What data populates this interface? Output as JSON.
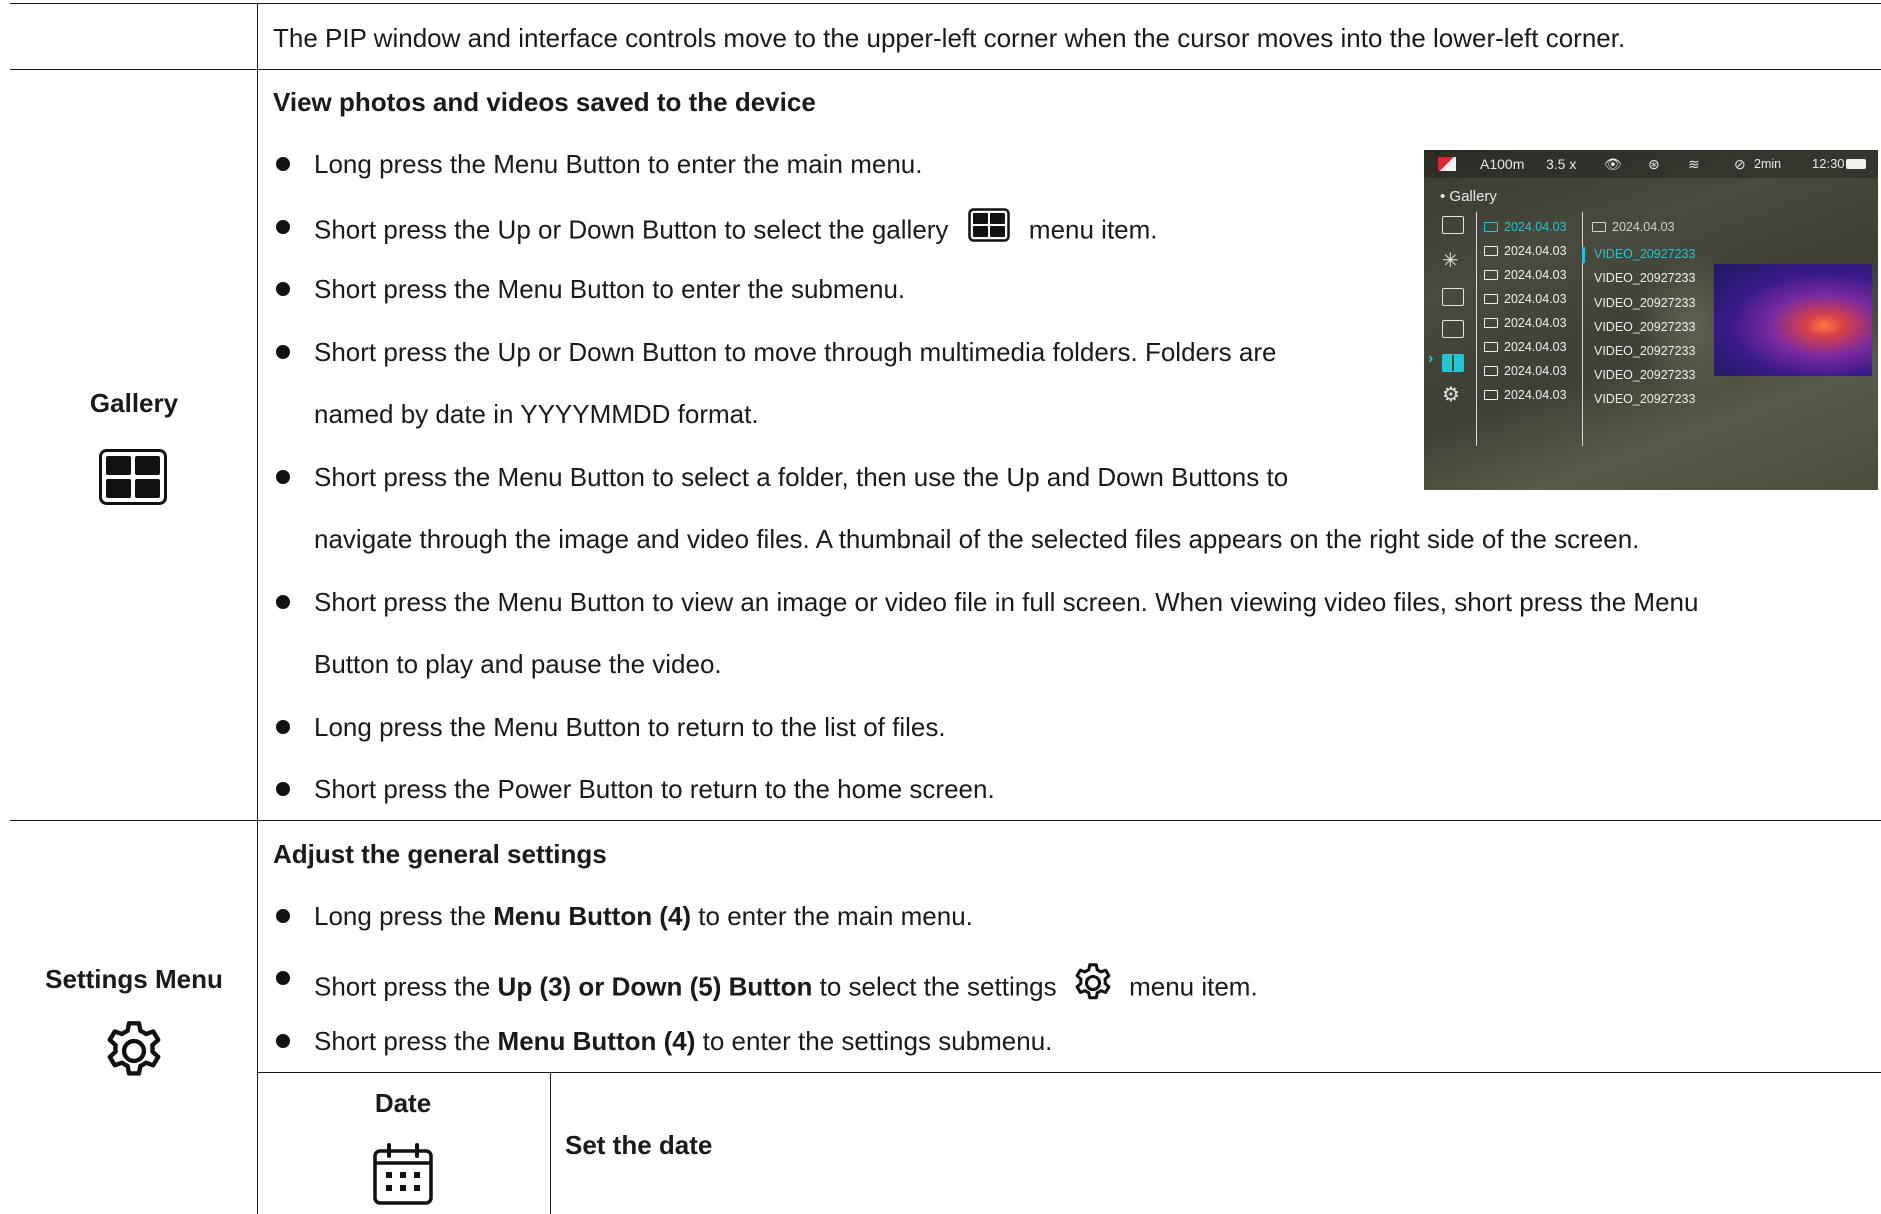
{
  "top_row": {
    "text": "The PIP window and interface controls move to the upper-left corner when the cursor moves into the lower-left corner."
  },
  "gallery": {
    "label": "Gallery",
    "icon": "gallery-icon",
    "heading": "View photos and videos saved to the device",
    "bullets": [
      {
        "text": "Long press the Menu Button to enter the main menu."
      },
      {
        "before": "Short press the Up or Down Button to select the gallery",
        "after": "menu item."
      },
      {
        "text": "Short press the Menu Button to enter the submenu."
      },
      {
        "line1": "Short press the Up or Down Button to move through multimedia folders. Folders are",
        "line2": "named by date in YYYYMMDD format."
      },
      {
        "line1": "Short press the Menu Button to select a folder, then use the Up and Down Buttons to",
        "line2": "navigate through the image and video files. A thumbnail of the selected files appears on the right side of the screen."
      },
      {
        "line1": "Short press the Menu Button to view an image or video file in full screen. When viewing video files, short press the Menu",
        "line2": "Button to play and pause the video."
      },
      {
        "text": "Long press the Menu Button to return to the list of files."
      },
      {
        "text": "Short press the Power Button to return to the home screen."
      }
    ],
    "device_screen": {
      "status": {
        "range": "A100m",
        "zoom": "3.5 x",
        "timer": "2min",
        "time": "12:30"
      },
      "title": "• Gallery",
      "folders": [
        "2024.04.03",
        "2024.04.03",
        "2024.04.03",
        "2024.04.03",
        "2024.04.03",
        "2024.04.03",
        "2024.04.03",
        "2024.04.03"
      ],
      "selected_folder": "2024.04.03",
      "videos": [
        "VIDEO_20927233",
        "VIDEO_20927233",
        "VIDEO_20927233",
        "VIDEO_20927233",
        "VIDEO_20927233",
        "VIDEO_20927233",
        "VIDEO_20927233"
      ],
      "accent": "#22c7d6"
    }
  },
  "settings": {
    "label": "Settings Menu",
    "icon": "gear-icon",
    "heading": "Adjust the general settings",
    "b1": {
      "pre": "Long press the ",
      "bold": "Menu Button (4)",
      "post": " to enter the main menu."
    },
    "b2": {
      "pre": "Short press the ",
      "bold": "Up (3) or Down (5) Button",
      "mid": " to select the settings ",
      "post": " menu item."
    },
    "b3": {
      "pre": "Short press the ",
      "bold": "Menu Button (4)",
      "post": " to enter the settings submenu."
    }
  },
  "date": {
    "label": "Date",
    "icon": "calendar-icon",
    "heading": "Set the date"
  }
}
